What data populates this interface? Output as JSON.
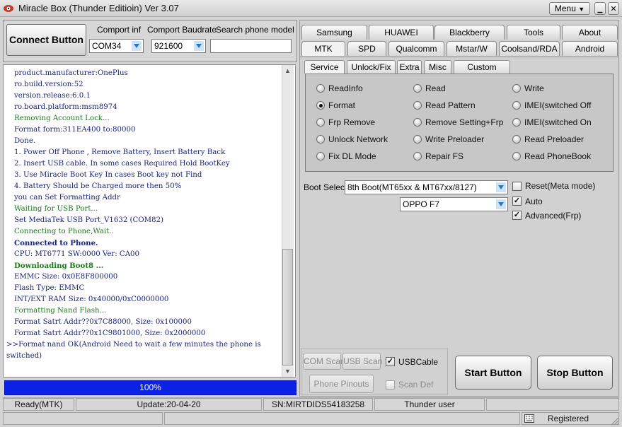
{
  "window": {
    "title": "Miracle Box (Thunder Editioin) Ver 3.07",
    "menu_label": "Menu",
    "minimize_glyph": "▁",
    "close_glyph": "✕"
  },
  "connection": {
    "connect_label": "Connect Button",
    "comport_label": "Comport inf",
    "comport_value": "COM34",
    "baud_label": "Comport Baudrate",
    "baud_value": "921600",
    "search_label": "Search phone model",
    "search_value": ""
  },
  "log": [
    {
      "text": "product.manufacturer:OnePlus",
      "style": ""
    },
    {
      "text": "ro.build.version:52",
      "style": ""
    },
    {
      "text": "version.release:6.0.1",
      "style": ""
    },
    {
      "text": "ro.board.platform:msm8974",
      "style": ""
    },
    {
      "text": "Removing Account Lock...",
      "style": "g"
    },
    {
      "text": "Format form:311EA400 to:80000",
      "style": ""
    },
    {
      "text": "Done.",
      "style": ""
    },
    {
      "text": "1. Power Off Phone , Remove Battery, Insert Battery Back",
      "style": ""
    },
    {
      "text": "2. Insert USB cable. In some cases Required Hold BootKey",
      "style": ""
    },
    {
      "text": "3. Use Miracle Boot Key In cases Boot key not Find",
      "style": ""
    },
    {
      "text": "4. Battery Should be Charged more then 50%",
      "style": ""
    },
    {
      "text": "you can Set Formatting Addr",
      "style": ""
    },
    {
      "text": "Waiting for USB Port...",
      "style": "g"
    },
    {
      "text": "Set MediaTek USB Port_V1632 (COM82)",
      "style": ""
    },
    {
      "text": "Connecting to Phone,Wait..",
      "style": "g"
    },
    {
      "text": "Connected to Phone.",
      "style": "b"
    },
    {
      "text": "CPU: MT6771 SW:0000 Ver: CA00",
      "style": ""
    },
    {
      "text": "Downloading Boot8 ...",
      "style": "bg"
    },
    {
      "text": "EMMC Size: 0x0E8F800000",
      "style": ""
    },
    {
      "text": "Flash Type: EMMC",
      "style": ""
    },
    {
      "text": "INT/EXT RAM  Size: 0x40000/0xC0000000",
      "style": ""
    },
    {
      "text": "Formatting Nand Flash...",
      "style": "g"
    },
    {
      "text": "Format Satrt Addr??0x7C88000, Size: 0x100000",
      "style": ""
    },
    {
      "text": "Format Satrt Addr??0x1C9801000, Size: 0x2000000",
      "style": ""
    },
    {
      "text": ">>Format nand OK(Android Need to wait a few minutes the phone is switched)",
      "style": "ind"
    }
  ],
  "progress": {
    "label": "100%",
    "value": 100
  },
  "brand_tabs_row1": [
    "Samsung",
    "HUAWEI",
    "Blackberry",
    "Tools",
    "About"
  ],
  "brand_tabs_row2": [
    "MTK",
    "SPD",
    "Qualcomm",
    "Mstar/W",
    "Coolsand/RDA",
    "Android"
  ],
  "active_brand_tab": "MTK",
  "sub_tabs": [
    "Service",
    "Unlock/Fix",
    "Extra",
    "Misc",
    "Custom Setting"
  ],
  "active_sub_tab": "Service",
  "service_options": [
    {
      "label": "ReadInfo",
      "selected": false
    },
    {
      "label": "Read",
      "selected": false
    },
    {
      "label": "Write",
      "selected": false
    },
    {
      "label": "Format",
      "selected": true
    },
    {
      "label": "Read Pattern",
      "selected": false
    },
    {
      "label": "IMEI(switched Off",
      "selected": false
    },
    {
      "label": "Frp Remove",
      "selected": false
    },
    {
      "label": "Remove Setting+Frp",
      "selected": false
    },
    {
      "label": "IMEI(switched On",
      "selected": false
    },
    {
      "label": "Unlock Network",
      "selected": false
    },
    {
      "label": "Write Preloader",
      "selected": false
    },
    {
      "label": "Read Preloader",
      "selected": false
    },
    {
      "label": "Fix DL Mode",
      "selected": false
    },
    {
      "label": "Repair FS",
      "selected": false
    },
    {
      "label": "Read PhoneBook",
      "selected": false
    }
  ],
  "boot": {
    "label": "Boot Select:",
    "value": "8th Boot(MT65xx & MT67xx/8127)",
    "model": "OPPO F7"
  },
  "options": {
    "reset_label": "Reset(Meta mode)",
    "reset_checked": false,
    "auto_label": "Auto",
    "auto_checked": true,
    "advanced_label": "Advanced(Frp)",
    "advanced_checked": true
  },
  "bottom": {
    "com_scan": "COM Scan",
    "usb_scan": "USB Scan",
    "usbcable_label": "USBCable",
    "usbcable_checked": true,
    "phone_pinouts": "Phone Pinouts",
    "scan_def": "Scan Def",
    "start": "Start Button",
    "stop": "Stop Button"
  },
  "status": {
    "mode": "Ready(MTK)",
    "update": "Update:20-04-20",
    "sn": "SN:MIRTDIDS54183258",
    "user": "Thunder user",
    "registered": "Registered"
  },
  "colors": {
    "progress": "#0b22e6",
    "log_text": "#1a237e",
    "log_green": "#1b7a1b"
  }
}
